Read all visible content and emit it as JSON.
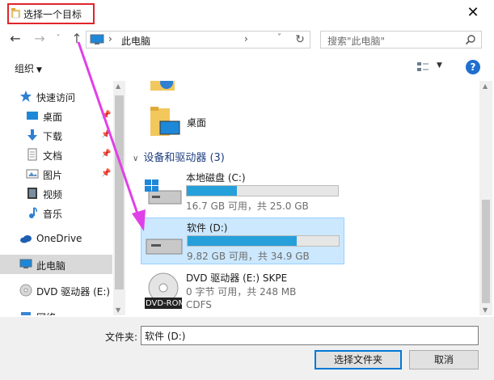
{
  "window": {
    "title": "选择一个目标",
    "close_glyph": "✕"
  },
  "navigation": {
    "back_glyph": "←",
    "forward_glyph": "→",
    "recent_glyph": "˅",
    "up_glyph": "↑",
    "address_separator": "›",
    "address_location": "此电脑",
    "address_chevron": "›",
    "address_dropdown_glyph": "˅",
    "refresh_glyph": "↻",
    "search_placeholder": "搜索\"此电脑\""
  },
  "toolbar": {
    "organize_label": "组织",
    "organize_arrow": "▼",
    "view_dropdown_glyph": "▼",
    "help_label": "?"
  },
  "sidebar": {
    "items": [
      {
        "label": "快速访问",
        "icon": "star-icon"
      },
      {
        "label": "桌面",
        "icon": "desktop-icon",
        "pinned": true
      },
      {
        "label": "下载",
        "icon": "download-icon",
        "pinned": true
      },
      {
        "label": "文档",
        "icon": "document-icon",
        "pinned": true
      },
      {
        "label": "图片",
        "icon": "picture-icon",
        "pinned": true
      },
      {
        "label": "视频",
        "icon": "video-icon"
      },
      {
        "label": "音乐",
        "icon": "music-icon"
      },
      {
        "label": "OneDrive",
        "icon": "cloud-icon"
      },
      {
        "label": "此电脑",
        "icon": "computer-icon",
        "selected": true
      },
      {
        "label": "DVD 驱动器 (E:) S",
        "icon": "dvd-icon"
      },
      {
        "label": "网络",
        "icon": "network-icon"
      }
    ],
    "pin_glyph": "📌",
    "scroll_up_glyph": "▲",
    "scroll_down_glyph": "▼"
  },
  "content": {
    "folders": [
      {
        "label": "桌面",
        "icon": "desktop-folder-icon"
      }
    ],
    "group_chevron": "∨",
    "group_title": "设备和驱动器 (3)",
    "drives": [
      {
        "name": "本地磁盘 (C:)",
        "info": "16.7 GB 可用，共 25.0 GB",
        "used_fraction": 0.33,
        "icon": "hard-drive-windows-icon"
      },
      {
        "name": "软件 (D:)",
        "info": "9.82 GB 可用，共 34.9 GB",
        "used_fraction": 0.72,
        "selected": true,
        "icon": "hard-drive-icon"
      },
      {
        "name": "DVD 驱动器 (E:) SKPE",
        "info": "0 字节 可用，共 248 MB",
        "info2": "CDFS",
        "icon": "dvd-rom-icon",
        "icon_label": "DVD-ROM"
      }
    ],
    "scroll_up_glyph": "▲",
    "scroll_down_glyph": "▼"
  },
  "footer": {
    "folder_label": "文件夹:",
    "folder_value": "软件 (D:)",
    "select_button": "选择文件夹",
    "cancel_button": "取消"
  },
  "colors": {
    "highlight_box": "#e0252a",
    "annotation_arrow": "#e040e8",
    "selection": "#cce8ff",
    "drive_fill": "#26a0da",
    "accent": "#0078d7"
  }
}
